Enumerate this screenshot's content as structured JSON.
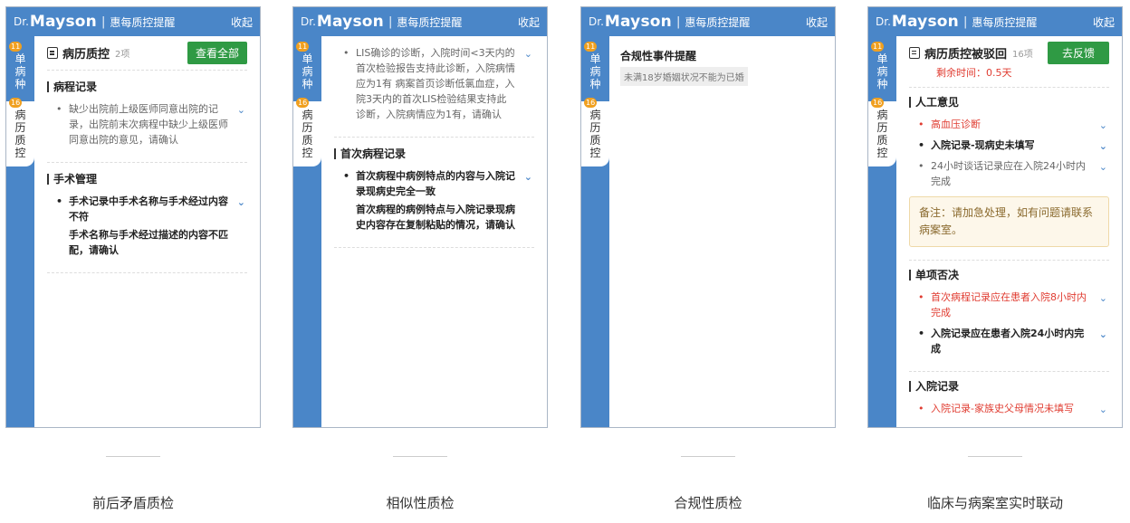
{
  "header": {
    "dr": "Dr.",
    "brand": "Mayson",
    "sep": "|",
    "sub": "惠每质控提醒",
    "collapse": "收起"
  },
  "sidebar": {
    "tab1": {
      "label": "单病种",
      "badge": "11"
    },
    "tab2": {
      "label": "病历质控",
      "badge": "16"
    }
  },
  "panel1": {
    "title": "病历质控",
    "count": "2项",
    "button": "查看全部",
    "sections": [
      {
        "heading": "病程记录",
        "items": [
          {
            "text": "缺少出院前上级医师同意出院的记录，出院前末次病程中缺少上级医师同意出院的意见，请确认"
          }
        ]
      },
      {
        "heading": "手术管理",
        "items": [
          {
            "title": "手术记录中手术名称与手术经过内容不符",
            "detail": "手术名称与手术经过描述的内容不匹配，请确认"
          }
        ]
      }
    ]
  },
  "panel2": {
    "top_item": "LIS确诊的诊断，入院时间<3天内的首次检验报告支持此诊断，入院病情应为1有 病案首页诊断低氯血症，入院3天内的首次LIS检验结果支持此诊断，入院病情应为1有，请确认",
    "section_heading": "首次病程记录",
    "item_title": "首次病程中病例特点的内容与入院记录现病史完全一致",
    "item_detail": "首次病程的病例特点与入院记录现病史内容存在复制粘贴的情况，请确认"
  },
  "panel3": {
    "title": "合规性事件提醒",
    "pill": "未满18岁婚姻状况不能为已婚"
  },
  "panel4": {
    "title": "病历质控被驳回",
    "count": "16项",
    "button": "去反馈",
    "remain": "剩余时间：0.5天",
    "sec1": {
      "heading": "人工意见",
      "items": [
        "高血压诊断",
        "入院记录-现病史未填写",
        "24小时谈话记录应在入院24小时内完成"
      ]
    },
    "note": "备注：请加急处理，如有问题请联系病案室。",
    "sec2": {
      "heading": "单项否决",
      "items": [
        "首次病程记录应在患者入院8小时内完成",
        "入院记录应在患者入院24小时内完成"
      ]
    },
    "sec3": {
      "heading": "入院记录",
      "items": [
        "入院记录-家族史父母情况未填写"
      ]
    }
  },
  "captions": [
    "前后矛盾质检",
    "相似性质检",
    "合规性质检",
    "临床与病案室实时联动"
  ],
  "icons": {
    "chevron": "chevron-down-icon",
    "doc": "document-icon"
  },
  "colors": {
    "header": "#4a86c8",
    "green": "#2f9a44",
    "red": "#e03c31",
    "badge": "#f0a020"
  }
}
